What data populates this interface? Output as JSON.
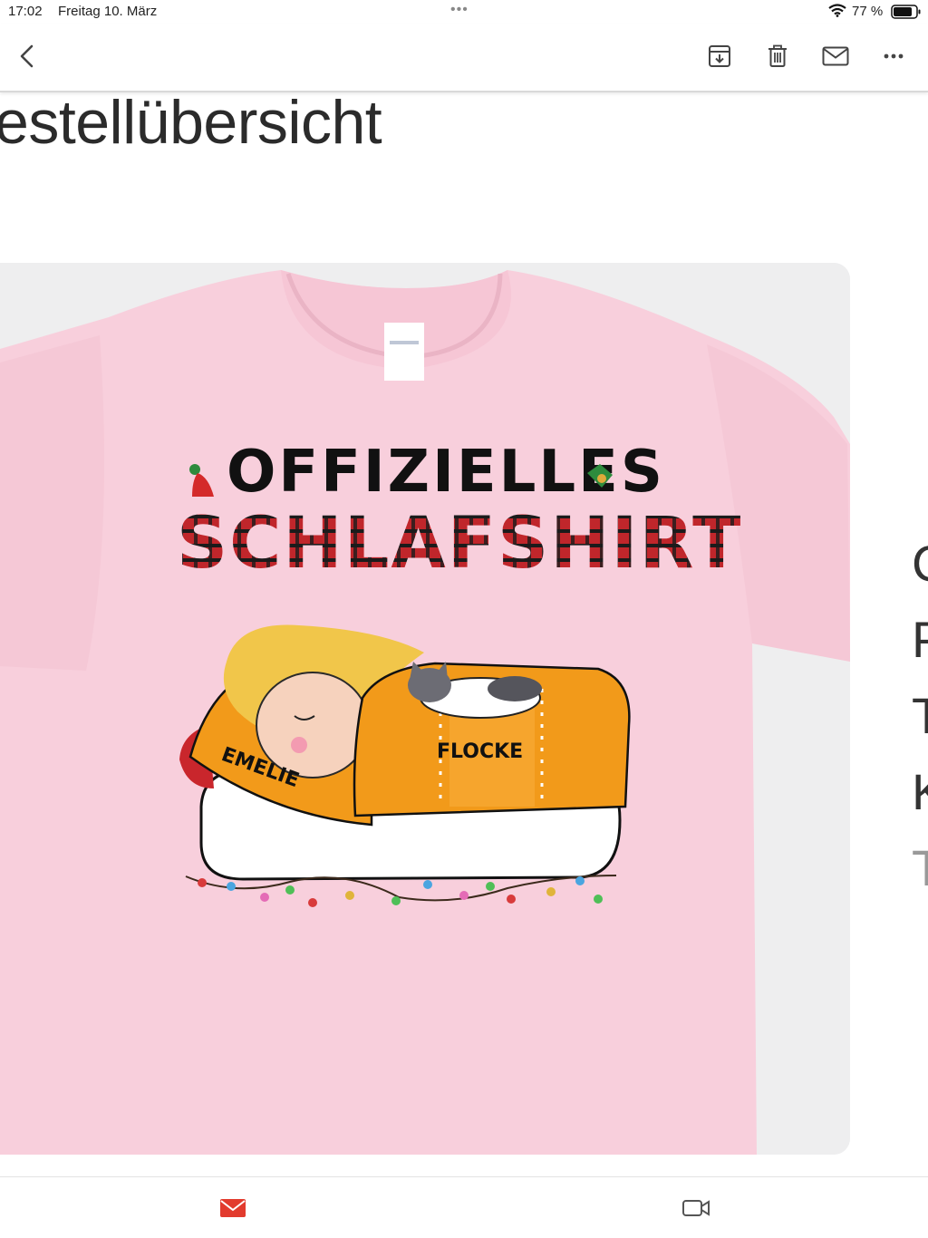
{
  "status": {
    "time": "17:02",
    "date": "Freitag 10. März",
    "battery": "77 %"
  },
  "mail": {
    "heading": "estellübersicht"
  },
  "product": {
    "shirt_line1": "OFFIZIELLES",
    "shirt_line2": "SCHLAFSHIRT",
    "person_name": "EMELIE",
    "pet_name": "FLOCKE",
    "shirt_color": "#f8cfdc",
    "card_background": "#eeeeef"
  },
  "clipped_right_text": [
    "C",
    "P",
    "T",
    "K",
    "T"
  ],
  "icons": {
    "back": "chevron-left-icon",
    "archive": "archive-icon",
    "delete": "trash-icon",
    "mark": "envelope-icon",
    "more": "more-icon",
    "tab_mail": "mail-icon",
    "tab_video": "video-icon"
  },
  "colors": {
    "accent_red": "#e23b2e"
  }
}
